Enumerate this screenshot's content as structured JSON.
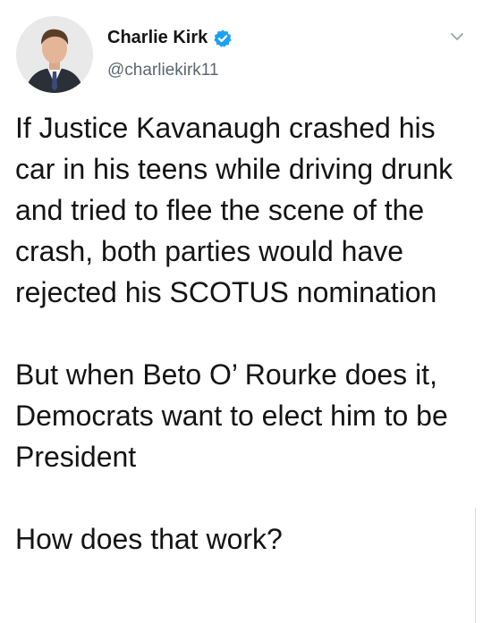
{
  "tweet": {
    "author": {
      "display_name": "Charlie Kirk",
      "handle": "@charliekirk11",
      "verified": true
    },
    "paragraphs": [
      "If Justice Kavanaugh crashed his car in his teens while driving drunk and tried to flee the scene of the crash, both parties would have rejected his SCOTUS nomination",
      "But when Beto O’ Rourke does it, Democrats want to elect him to be President",
      "How does that work?"
    ]
  },
  "icons": {
    "verified": "verified-badge-icon",
    "menu": "chevron-down-icon"
  },
  "colors": {
    "verified_blue": "#1da1f2",
    "handle_gray": "#5b6670",
    "text": "#141414"
  }
}
